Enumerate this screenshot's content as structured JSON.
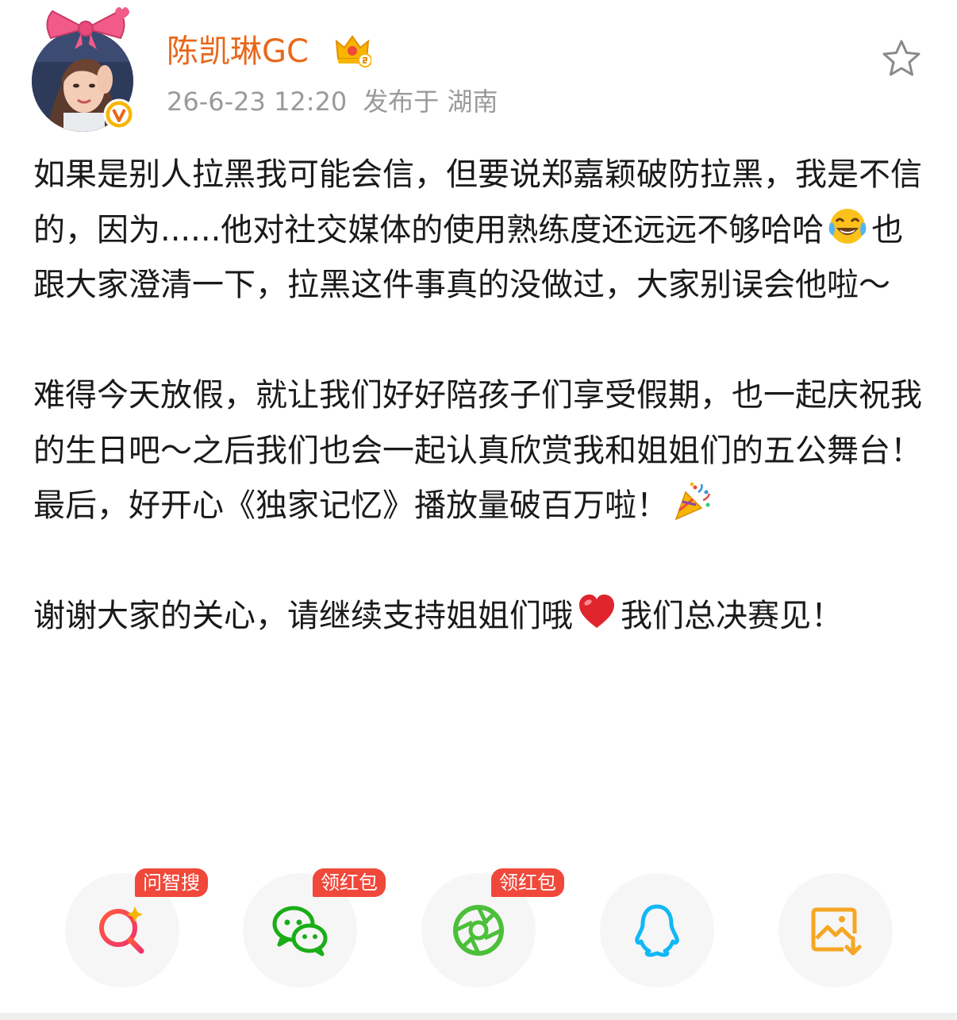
{
  "user": {
    "name": "陈凯琳GC",
    "timestamp": "26-6-23 12:20",
    "location": "发布于 湖南"
  },
  "post": {
    "paragraphs": [
      {
        "before": "如果是别人拉黑我可能会信，但要说郑嘉颖破防拉黑，我是不信的，因为......他对社交媒体的使用熟练度还远远不够哈哈",
        "emoji": "laughing-tears-emoji",
        "after": "也跟大家澄清一下，拉黑这件事真的没做过，大家别误会他啦～"
      },
      {
        "before": "难得今天放假，就让我们好好陪孩子们享受假期，也一起庆祝我的生日吧～之后我们也会一起认真欣赏我和姐姐们的五公舞台！最后，好开心《独家记忆》播放量破百万啦！",
        "emoji": "party-popper-emoji",
        "after": ""
      },
      {
        "before": "谢谢大家的关心，请继续支持姐姐们哦",
        "emoji": "red-heart-emoji",
        "after": "我们总决赛见！"
      }
    ]
  },
  "share": {
    "items": [
      {
        "name": "search-ai",
        "icon": "ai-search-icon",
        "tag": "问智搜"
      },
      {
        "name": "wechat",
        "icon": "wechat-icon",
        "tag": "领红包"
      },
      {
        "name": "moments",
        "icon": "moments-aperture-icon",
        "tag": "领红包"
      },
      {
        "name": "qq",
        "icon": "qq-penguin-icon",
        "tag": ""
      },
      {
        "name": "save-image",
        "icon": "save-image-icon",
        "tag": ""
      }
    ]
  },
  "colors": {
    "username": "#e8681a",
    "meta": "#9a9a9a",
    "tag": "#f0483a",
    "wechat": "#1aad19",
    "qq": "#12b7f5",
    "save": "#f5a623"
  }
}
